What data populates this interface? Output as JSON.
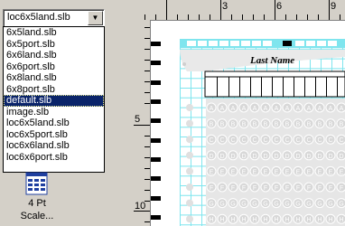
{
  "combo": {
    "value": "loc6x5land.slb",
    "arrow": "▼"
  },
  "dropdown": {
    "items": [
      "6x5land.slb",
      "6x5port.slb",
      "6x6land.slb",
      "6x6port.slb",
      "6x8land.slb",
      "6x8port.slb",
      "default.slb",
      "image.slb",
      "loc6x5land.slb",
      "loc6x5port.slb",
      "loc6x6land.slb",
      "loc6x6port.slb"
    ],
    "selected_index": 6
  },
  "tool": {
    "label_line1": "4 Pt",
    "label_line2": "Scale..."
  },
  "hruler": {
    "labels": [
      "3",
      "6",
      "9"
    ]
  },
  "vruler": {
    "labels": [
      "5",
      "10"
    ]
  },
  "form": {
    "last_name_label": "Last Name",
    "bubble_letters": [
      "A",
      "B",
      "C",
      "D",
      "E",
      "F",
      "G",
      "H"
    ]
  },
  "colors": {
    "selection": "#0a246a",
    "grid": "#7fe5ee",
    "bubble": "#d8d8d8"
  }
}
